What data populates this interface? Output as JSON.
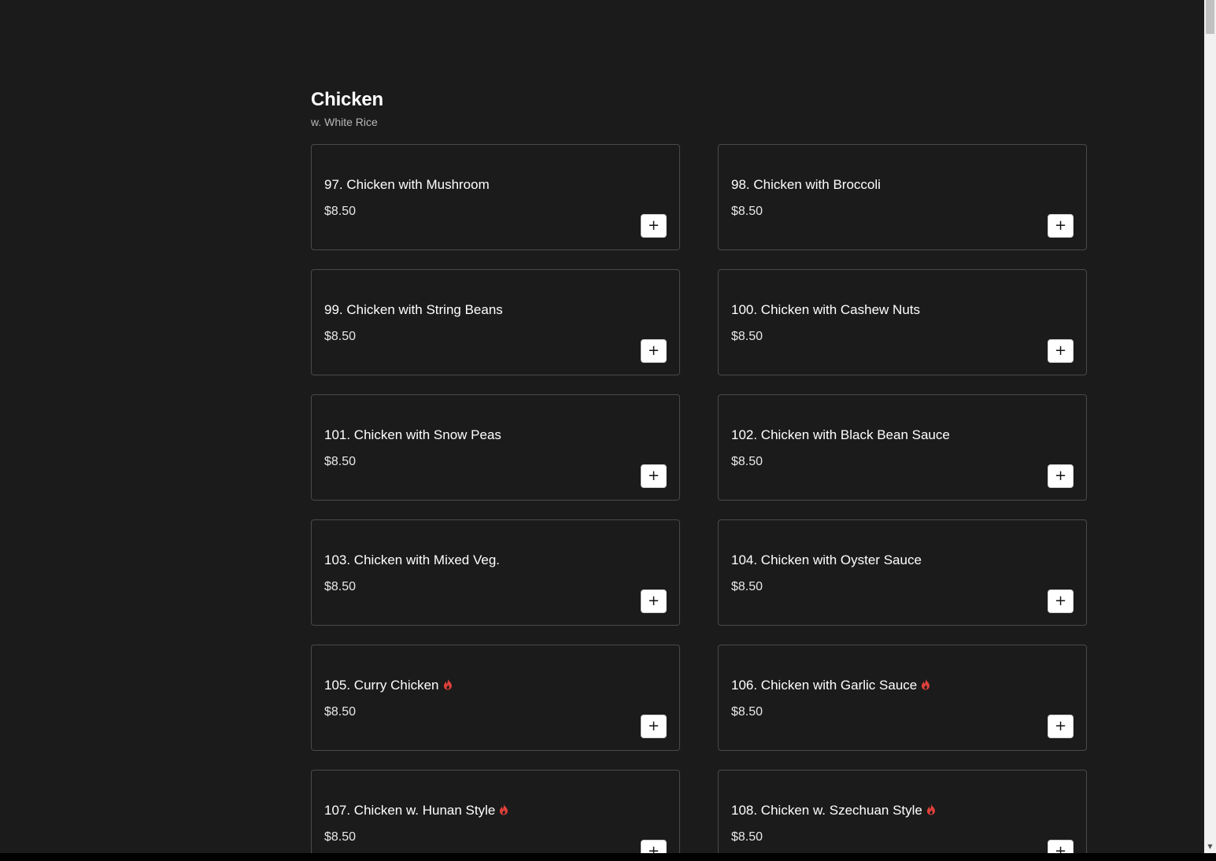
{
  "section": {
    "title": "Chicken",
    "subtitle": "w. White Rice"
  },
  "add_label": "+",
  "colors": {
    "background": "#1b1b1b",
    "card_border": "#4a4a4a",
    "spicy": "#e0403a"
  },
  "items": [
    {
      "name": "97. Chicken with Mushroom",
      "price": "$8.50",
      "spicy": false
    },
    {
      "name": "98. Chicken with Broccoli",
      "price": "$8.50",
      "spicy": false
    },
    {
      "name": "99. Chicken with String Beans",
      "price": "$8.50",
      "spicy": false
    },
    {
      "name": "100. Chicken with Cashew Nuts",
      "price": "$8.50",
      "spicy": false
    },
    {
      "name": "101. Chicken with Snow Peas",
      "price": "$8.50",
      "spicy": false
    },
    {
      "name": "102. Chicken with Black Bean Sauce",
      "price": "$8.50",
      "spicy": false
    },
    {
      "name": "103. Chicken with Mixed Veg.",
      "price": "$8.50",
      "spicy": false
    },
    {
      "name": "104. Chicken with Oyster Sauce",
      "price": "$8.50",
      "spicy": false
    },
    {
      "name": "105. Curry Chicken",
      "price": "$8.50",
      "spicy": true
    },
    {
      "name": "106. Chicken with Garlic Sauce",
      "price": "$8.50",
      "spicy": true
    },
    {
      "name": "107. Chicken w. Hunan Style",
      "price": "$8.50",
      "spicy": true
    },
    {
      "name": "108. Chicken w. Szechuan Style",
      "price": "$8.50",
      "spicy": true
    }
  ]
}
